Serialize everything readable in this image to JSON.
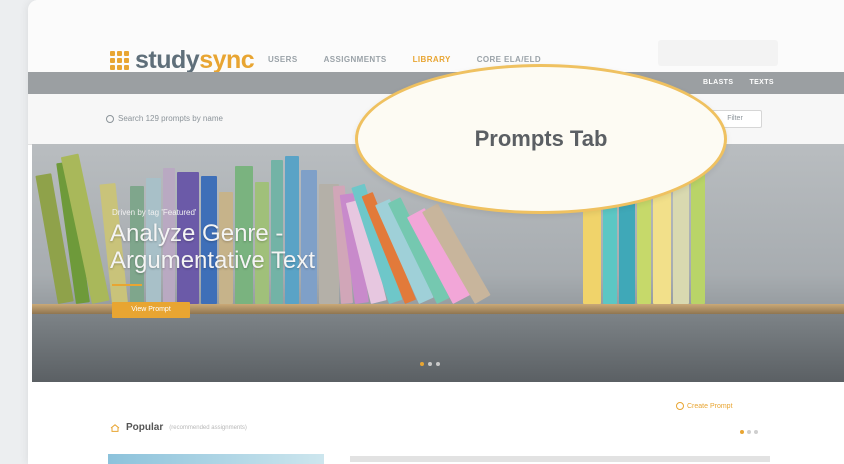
{
  "brand": {
    "name_part1": "study",
    "name_part2": "sync",
    "accent": "#e8a532"
  },
  "topnav": {
    "items": [
      {
        "label": "USERS"
      },
      {
        "label": "ASSIGNMENTS"
      },
      {
        "label": "LIBRARY",
        "active": true
      },
      {
        "label": "CORE ELA/ELD"
      }
    ]
  },
  "subnav": {
    "items": [
      {
        "label": ""
      },
      {
        "label": ""
      },
      {
        "label": ""
      },
      {
        "label": "BLASTS"
      },
      {
        "label": "TEXTS"
      }
    ]
  },
  "search": {
    "placeholder": "Search 129 prompts by name"
  },
  "filter": {
    "label": "Filter"
  },
  "hero": {
    "kicker": "Driven by tag 'Featured'",
    "title": "Analyze Genre - Argumentative Text",
    "button_label": "View Prompt",
    "dots": {
      "count": 3,
      "active": 0
    }
  },
  "popular": {
    "title": "Popular",
    "subtitle": "(recommended assignments)",
    "create_label": "Create Prompt",
    "pager": {
      "count": 3,
      "active": 0
    }
  },
  "callout": {
    "label": "Prompts Tab",
    "border_color": "#efc160"
  },
  "books": [
    "#8fa24a",
    "#6e9a3a",
    "#a9b85a",
    "#c9c37a",
    "#7fa68c",
    "#a8c0c8",
    "#b9a9c2",
    "#6b5aa8",
    "#3e6fb8",
    "#c6b38a",
    "#7ab37f",
    "#a0c07a",
    "#73b3a6",
    "#5aa3c6",
    "#7fa0c8",
    "#b4b0a8",
    "#d1a6b8",
    "#c88acb",
    "#e7c7e0",
    "#6ec7c9",
    "#e27a3a",
    "#9fd0d8",
    "#75c8b0",
    "#f2a6d8",
    "#c8b59c",
    "#f0d36a",
    "#5cc7c4",
    "#3fa8b8",
    "#c6d96a",
    "#f2e08a",
    "#d9d9b0",
    "#b9d468"
  ]
}
